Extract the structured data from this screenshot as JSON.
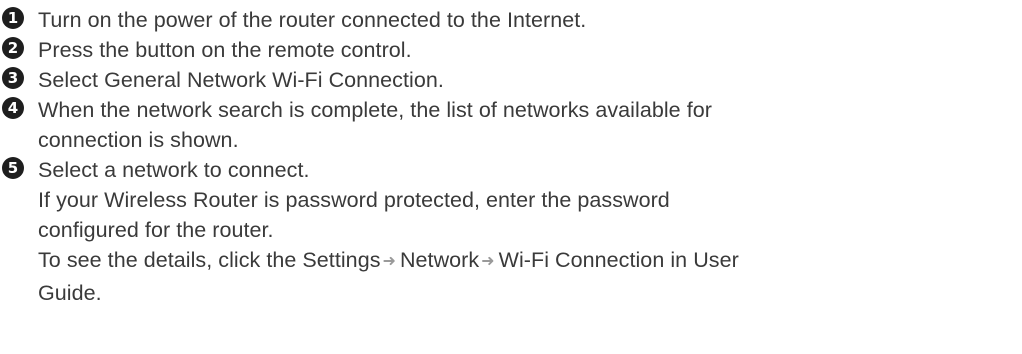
{
  "steps": [
    {
      "number": "1",
      "lines": [
        "Turn on the power of the router connected to the Internet."
      ]
    },
    {
      "number": "2",
      "lines": [
        "Press the button on the remote control."
      ]
    },
    {
      "number": "3",
      "lines": [
        "Select General Network Wi-Fi Connection."
      ]
    },
    {
      "number": "4",
      "lines": [
        "When the network search is complete, the list of networks available for",
        "connection is shown."
      ]
    },
    {
      "number": "5",
      "lines": [
        "Select a network to connect.",
        "If your Wireless Router is password protected, enter the password",
        "configured for the router."
      ],
      "path_line": {
        "prefix": "To see the details, click the Settings",
        "part2": "Network",
        "part3": "Wi-Fi Connection in User",
        "arrow": "➜"
      },
      "last_line": "Guide."
    }
  ]
}
